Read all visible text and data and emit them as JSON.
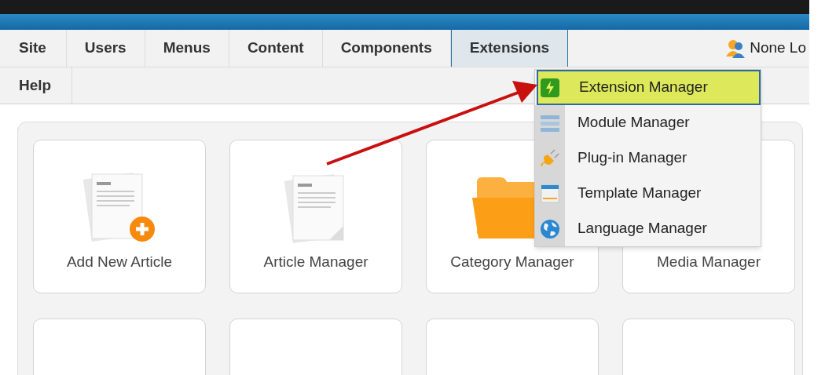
{
  "menu_bar": {
    "tabs": [
      {
        "label": "Site",
        "selected": false
      },
      {
        "label": "Users",
        "selected": false
      },
      {
        "label": "Menus",
        "selected": false
      },
      {
        "label": "Content",
        "selected": false
      },
      {
        "label": "Components",
        "selected": false
      },
      {
        "label": "Extensions",
        "selected": true
      },
      {
        "label": "Help",
        "selected": false
      }
    ],
    "user": "None Lo"
  },
  "dropdown": {
    "items": [
      {
        "label": "Extension Manager",
        "kind": "extension",
        "selected": true
      },
      {
        "label": "Module Manager",
        "kind": "module",
        "selected": false
      },
      {
        "label": "Plug-in Manager",
        "kind": "plugin",
        "selected": false
      },
      {
        "label": "Template Manager",
        "kind": "template",
        "selected": false
      },
      {
        "label": "Language Manager",
        "kind": "language",
        "selected": false
      }
    ]
  },
  "cards": [
    {
      "label": "Add New Article",
      "kind": "add-article"
    },
    {
      "label": "Article Manager",
      "kind": "article"
    },
    {
      "label": "Category Manager",
      "kind": "category"
    },
    {
      "label": "Media Manager",
      "kind": "media"
    }
  ]
}
